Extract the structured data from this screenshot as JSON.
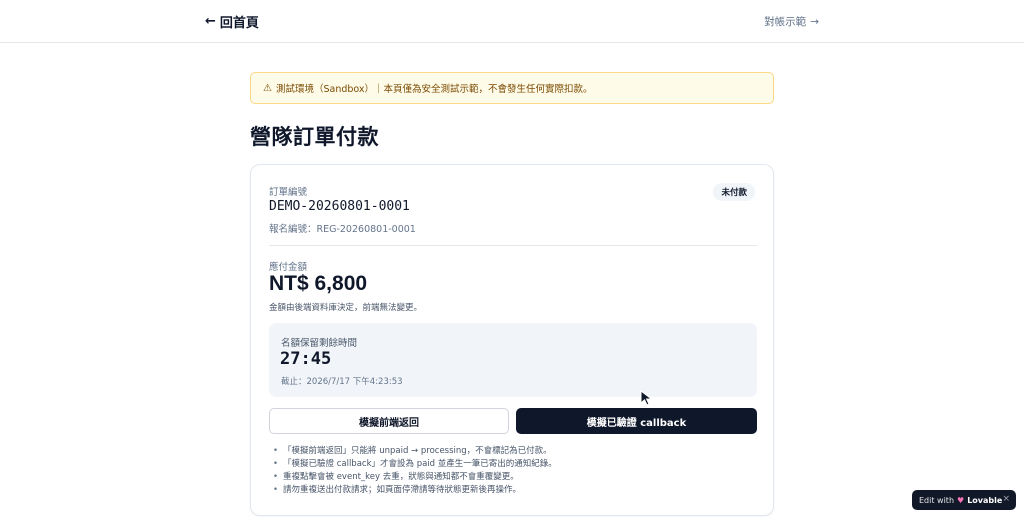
{
  "header": {
    "back_label": "回首頁",
    "back_arrow": "←",
    "recon_label": "對帳示範",
    "recon_arrow": "→"
  },
  "banner": {
    "icon": "warning-icon",
    "text": "測試環境（Sandbox）｜本頁僅為安全測試示範，不會發生任何實際扣款。"
  },
  "page": {
    "title": "營隊訂單付款"
  },
  "order": {
    "number_label": "訂單編號",
    "number": "DEMO-20260801-0001",
    "registration": "報名編號：REG-20260801-0001",
    "status": "未付款"
  },
  "payment": {
    "due_label": "應付金額",
    "amount": "NT$ 6,800",
    "note": "金額由後端資料庫決定，前端無法變更。"
  },
  "timer": {
    "label": "名額保留剩餘時間",
    "value": "27:45",
    "deadline": "截止：2026/7/17 下午4:23:53"
  },
  "actions": {
    "frontend_return": "模擬前端返回",
    "verified_callback": "模擬已驗證 callback"
  },
  "notes": [
    "「模擬前端返回」只能將 unpaid → processing，不會標記為已付款。",
    "「模擬已驗證 callback」才會設為 paid 並產生一筆已寄出的通知紀錄。",
    "重複點擊會被 event_key 去重，狀態與通知都不會重覆變更。",
    "請勿重複送出付款請求；如頁面停滯請等待狀態更新後再操作。"
  ],
  "badge": {
    "prefix": "Edit with",
    "brand": "Lovable",
    "close": "×"
  },
  "colors": {
    "primary_dark": "#0f172a",
    "banner_bg": "#fefce8",
    "banner_border": "#fcd88a",
    "banner_text": "#7c4a03",
    "muted": "#64748b"
  }
}
